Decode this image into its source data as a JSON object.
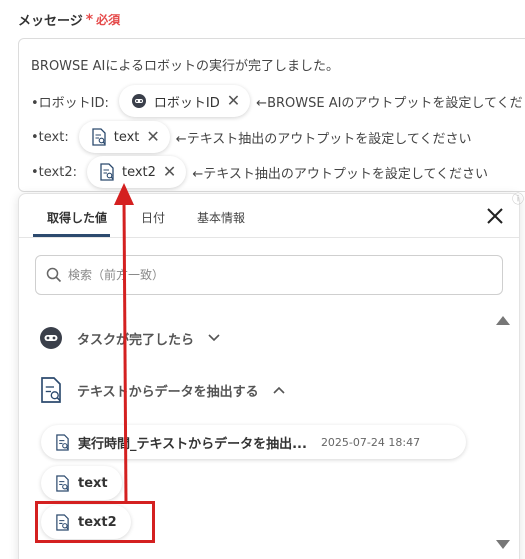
{
  "field": {
    "label": "メッセージ",
    "required_star": "*",
    "required_text": "必須"
  },
  "message": {
    "line1": "BROWSE AIによるロボットの実行が完了しました。",
    "line2_prefix": "•ロボットID:",
    "line2_chip": "ロボットID",
    "line2_suffix": "←BROWSE AIのアウトプットを設定してくだ",
    "line3_prefix": "•text:",
    "line3_chip": "text",
    "line3_suffix": "←テキスト抽出のアウトプットを設定してください",
    "line4_prefix": "•text2:",
    "line4_chip": "text2",
    "line4_suffix": "←テキスト抽出のアウトプットを設定してください"
  },
  "panel": {
    "tabs": [
      {
        "label": "取得した値"
      },
      {
        "label": "日付"
      },
      {
        "label": "基本情報"
      }
    ],
    "search_placeholder": "検索（前方一致）",
    "groups": [
      {
        "label": "タスクが完了したら",
        "icon": "robot-icon",
        "chevron": "chevron-down-icon"
      },
      {
        "label": "テキストからデータを抽出する",
        "icon": "document-search-icon",
        "chevron": "chevron-up-icon"
      }
    ],
    "items": [
      {
        "label": "実行時間_テキストからデータを抽出...",
        "date": "2025-07-24 18:47"
      },
      {
        "label": "text"
      },
      {
        "label": "text2"
      }
    ]
  },
  "colors": {
    "highlight": "#d42020",
    "required": "#e54a4a",
    "tab_underline": "#2c4a6e"
  }
}
